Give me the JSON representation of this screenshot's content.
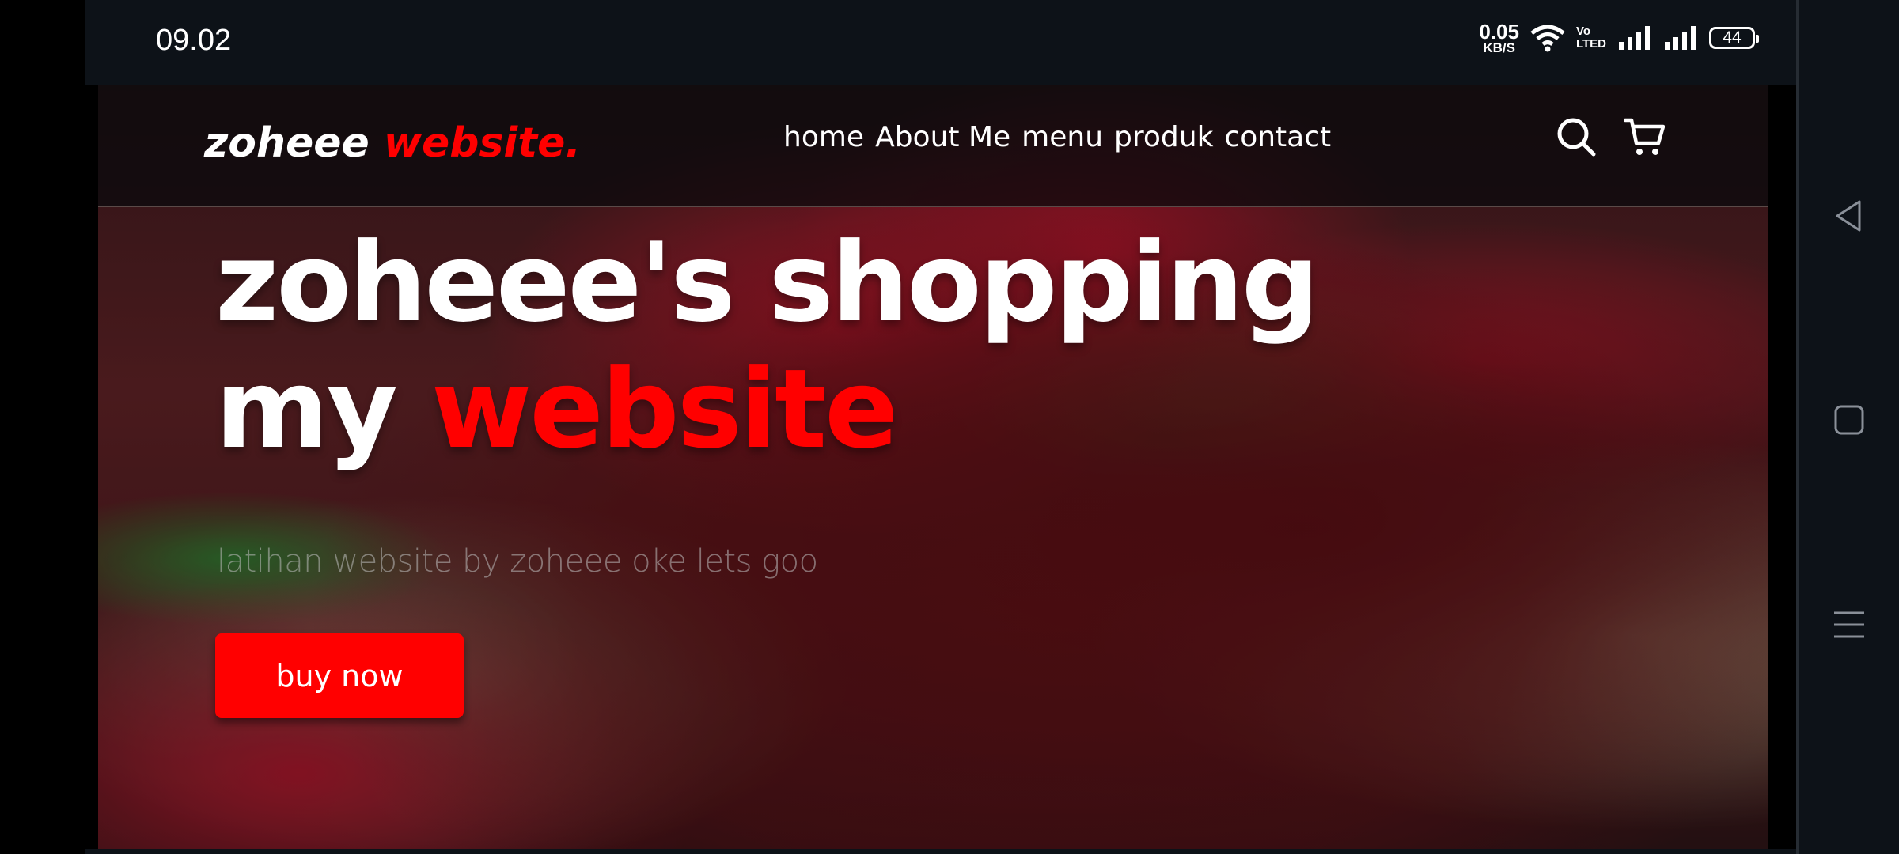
{
  "status_bar": {
    "time": "09.02",
    "net_speed_value": "0.05",
    "net_speed_unit": "KB/S",
    "volte_line1": "Vo",
    "volte_line2": "LTED",
    "battery": "44"
  },
  "header": {
    "logo_part1": "zoheee",
    "logo_part2": "website.",
    "menu": [
      "home",
      "About Me",
      "menu",
      "produk",
      "contact"
    ],
    "icons": [
      "search-icon",
      "cart-icon"
    ]
  },
  "hero": {
    "title_line1": "zoheee's shopping",
    "title_line2_white": "my",
    "title_line2_red": "website",
    "subtitle": "latihan website by zoheee oke lets goo",
    "button": "buy now"
  },
  "colors": {
    "accent": "#ff0000",
    "status_bg": "#0d1218"
  },
  "nav_buttons": [
    "back-icon",
    "home-icon",
    "recents-icon"
  ]
}
